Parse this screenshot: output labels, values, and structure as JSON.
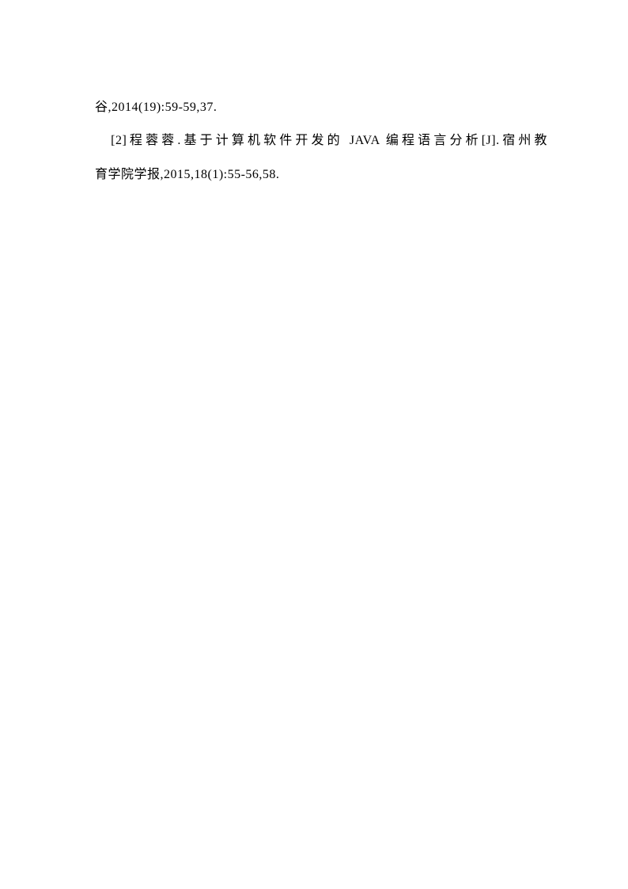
{
  "references": {
    "line1": "谷,2014(19):59-59,37.",
    "line2": "　[2]程蓉蓉.基于计算机软件开发的 JAVA 编程语言分析[J].宿州教",
    "line3": "育学院学报,2015,18(1):55-56,58."
  }
}
